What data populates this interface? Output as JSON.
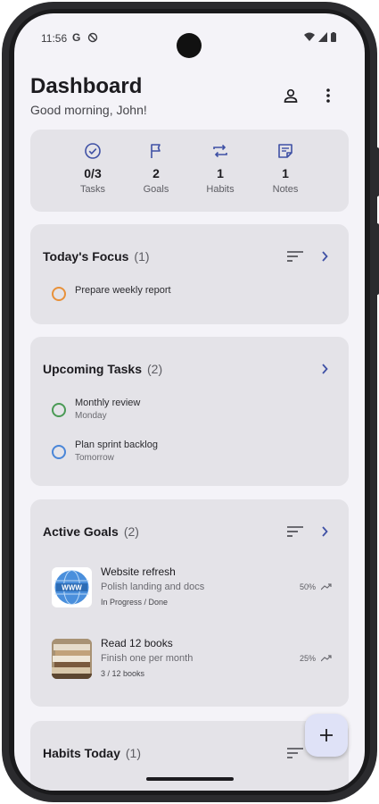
{
  "status_bar": {
    "time": "11:56",
    "g_label": "G"
  },
  "header": {
    "title": "Dashboard",
    "greeting": "Good morning, John!"
  },
  "stats": [
    {
      "icon": "check-circle-icon",
      "value": "0/3",
      "label": "Tasks"
    },
    {
      "icon": "flag-icon",
      "value": "2",
      "label": "Goals"
    },
    {
      "icon": "repeat-icon",
      "value": "1",
      "label": "Habits"
    },
    {
      "icon": "note-icon",
      "value": "1",
      "label": "Notes"
    }
  ],
  "focus": {
    "title": "Today's Focus",
    "count": "(1)",
    "items": [
      {
        "title": "Prepare weekly report",
        "color": "#e8913a"
      }
    ]
  },
  "upcoming": {
    "title": "Upcoming Tasks",
    "count": "(2)",
    "items": [
      {
        "title": "Monthly review",
        "due": "Monday",
        "color": "#4a9a55"
      },
      {
        "title": "Plan sprint backlog",
        "due": "Tomorrow",
        "color": "#4a86d8"
      }
    ]
  },
  "goals": {
    "title": "Active Goals",
    "count": "(2)",
    "items": [
      {
        "title": "Website refresh",
        "description": "Polish landing and docs",
        "meta": "In Progress / Done",
        "percent": "50%",
        "thumb": "www-globe",
        "thumb_text": "WWW"
      },
      {
        "title": "Read 12 books",
        "description": "Finish one per month",
        "meta": "3 / 12 books",
        "percent": "25%",
        "thumb": "books-photo"
      }
    ]
  },
  "habits": {
    "title": "Habits Today",
    "count": "(1)"
  },
  "colors": {
    "accent": "#3f51a5",
    "card": "#e4e3e8",
    "background": "#f4f3f8",
    "fab": "#dfe2f7"
  }
}
